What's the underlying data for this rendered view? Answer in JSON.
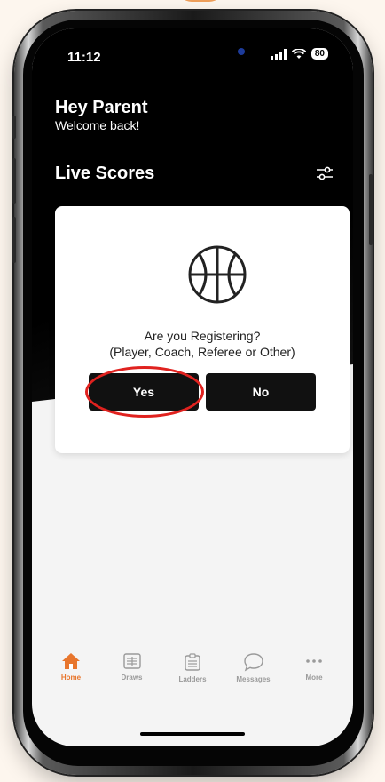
{
  "status_bar": {
    "time": "11:12",
    "battery": "80"
  },
  "header": {
    "title": "Hey Parent",
    "subtitle": "Welcome back!"
  },
  "section": {
    "title": "Live Scores"
  },
  "modal": {
    "question": "Are you Registering?",
    "options_note": "(Player, Coach, Referee or Other)",
    "yes_label": "Yes",
    "no_label": "No",
    "icon": "basketball-icon"
  },
  "tabbar": {
    "items": [
      {
        "label": "Home",
        "icon": "home-icon",
        "active": true
      },
      {
        "label": "Draws",
        "icon": "draws-icon",
        "active": false
      },
      {
        "label": "Ladders",
        "icon": "ladders-icon",
        "active": false
      },
      {
        "label": "Messages",
        "icon": "chat-bubble-icon",
        "active": false
      },
      {
        "label": "More",
        "icon": "more-dots-icon",
        "active": false
      }
    ]
  },
  "colors": {
    "accent": "#e8762d",
    "highlight": "#e0221f",
    "dark": "#111111"
  }
}
